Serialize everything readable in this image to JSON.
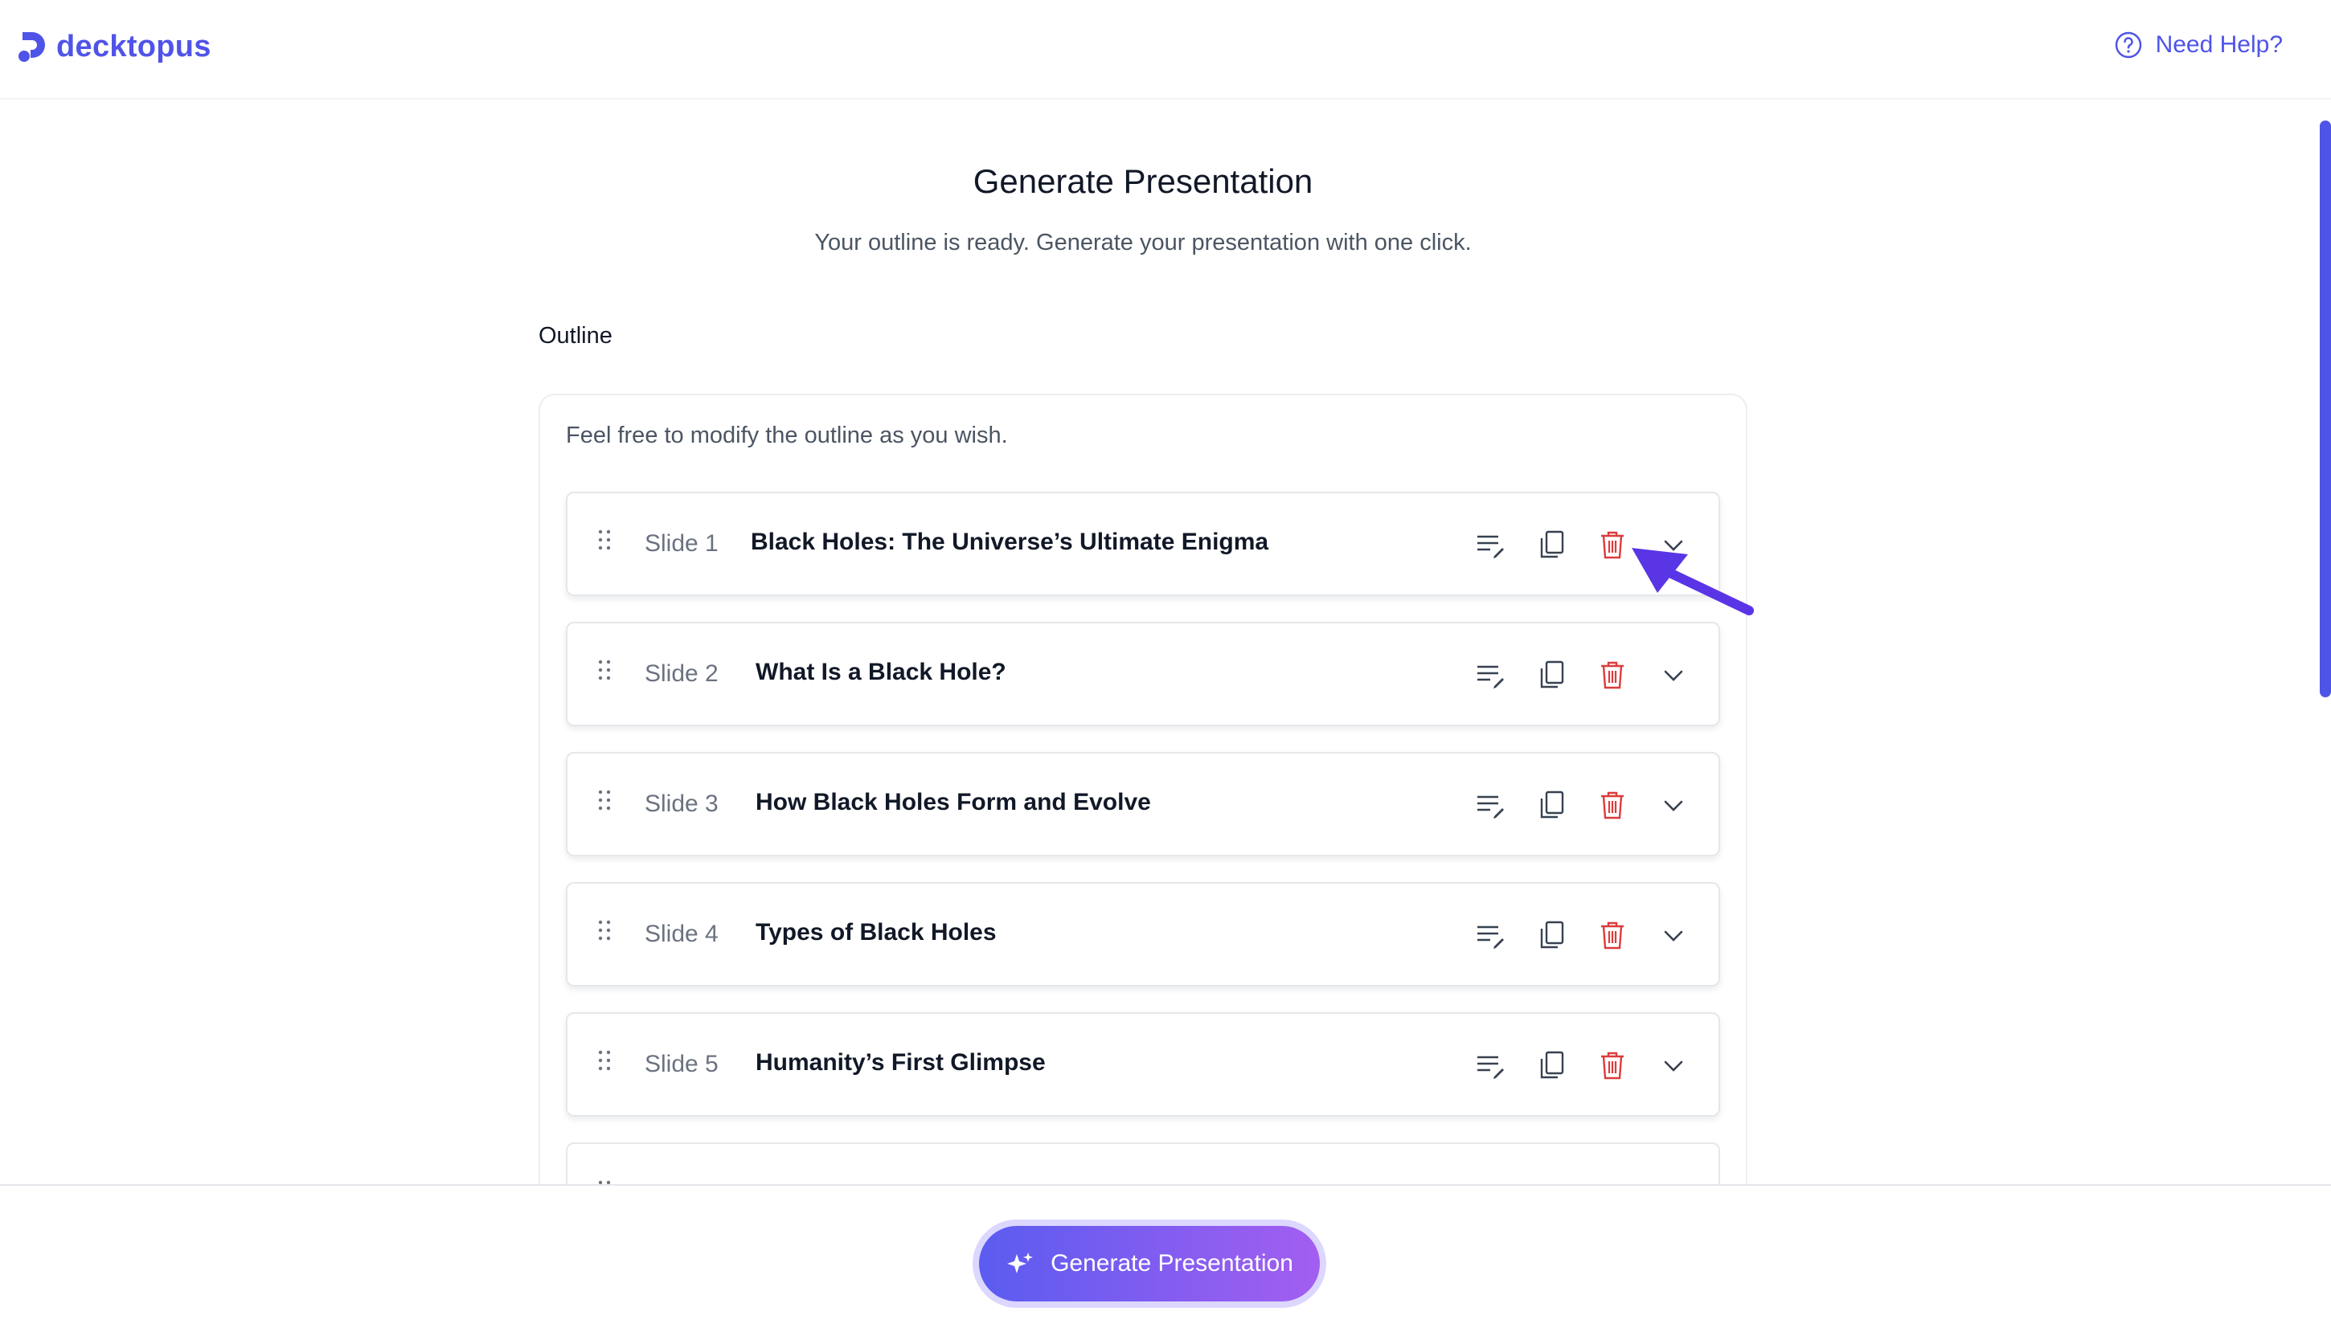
{
  "header": {
    "logo_text": "decktopus",
    "help_label": "Need Help?"
  },
  "main": {
    "title": "Generate Presentation",
    "subtitle": "Your outline is ready. Generate your presentation with one click.",
    "outline_heading": "Outline",
    "helper_text": "Feel free to modify the outline as you wish."
  },
  "slides": [
    {
      "num": "Slide 1",
      "title": "Black Holes: The Universe’s Ultimate Enigma"
    },
    {
      "num": "Slide 2",
      "title": "What Is a Black Hole?"
    },
    {
      "num": "Slide 3",
      "title": "How Black Holes Form and Evolve"
    },
    {
      "num": "Slide 4",
      "title": "Types of Black Holes"
    },
    {
      "num": "Slide 5",
      "title": "Humanity’s First Glimpse"
    }
  ],
  "actions": {
    "edit_icon": "edit-notes-icon",
    "copy_icon": "duplicate-icon",
    "delete_icon": "trash-icon",
    "expand_icon": "chevron-down-icon"
  },
  "footer": {
    "generate_label": "Generate Presentation"
  },
  "colors": {
    "brand": "#4f54e8",
    "delete": "#dc3b3b",
    "button_gradient_start": "#5b5cf0",
    "button_gradient_end": "#a35ef0"
  }
}
